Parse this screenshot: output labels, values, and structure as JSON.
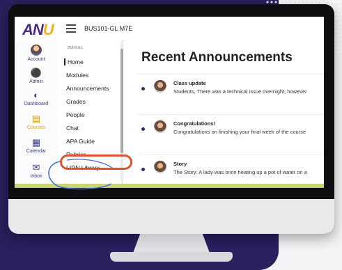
{
  "topbar": {
    "logo_a": "AN",
    "logo_u": "U",
    "course_title": "BUS101-GL M7E"
  },
  "global_nav": {
    "items": [
      {
        "label": "Account",
        "icon": "avatar"
      },
      {
        "label": "Admin",
        "icon": "shield-icon"
      },
      {
        "label": "Dashboard",
        "icon": "gauge-icon"
      },
      {
        "label": "Courses",
        "icon": "book-icon"
      },
      {
        "label": "Calendar",
        "icon": "calendar-icon"
      },
      {
        "label": "Inbox",
        "icon": "inbox-icon"
      }
    ]
  },
  "course_nav": {
    "term": "252-FULL",
    "items": [
      {
        "label": "Home"
      },
      {
        "label": "Modules"
      },
      {
        "label": "Announcements"
      },
      {
        "label": "Grades"
      },
      {
        "label": "People"
      },
      {
        "label": "Chat"
      },
      {
        "label": "APA Guide"
      },
      {
        "label": "Rubrics"
      },
      {
        "label": "LIRN Library"
      }
    ]
  },
  "main": {
    "heading": "Recent Announcements",
    "announcements": [
      {
        "title": "Class update",
        "snippet": "Students, There was a technical issue overnight; however"
      },
      {
        "title": "Congratulations!",
        "snippet": "Congratulations on finishing your final week of the course"
      },
      {
        "title": "Story",
        "snippet": "The Story: A lady was once heating up a pot of water on a"
      }
    ]
  },
  "colors": {
    "brand_purple": "#4b2a8c",
    "brand_gold": "#f2b318",
    "highlight_orange": "#d9542f",
    "background_purple": "#2b1f5e"
  }
}
